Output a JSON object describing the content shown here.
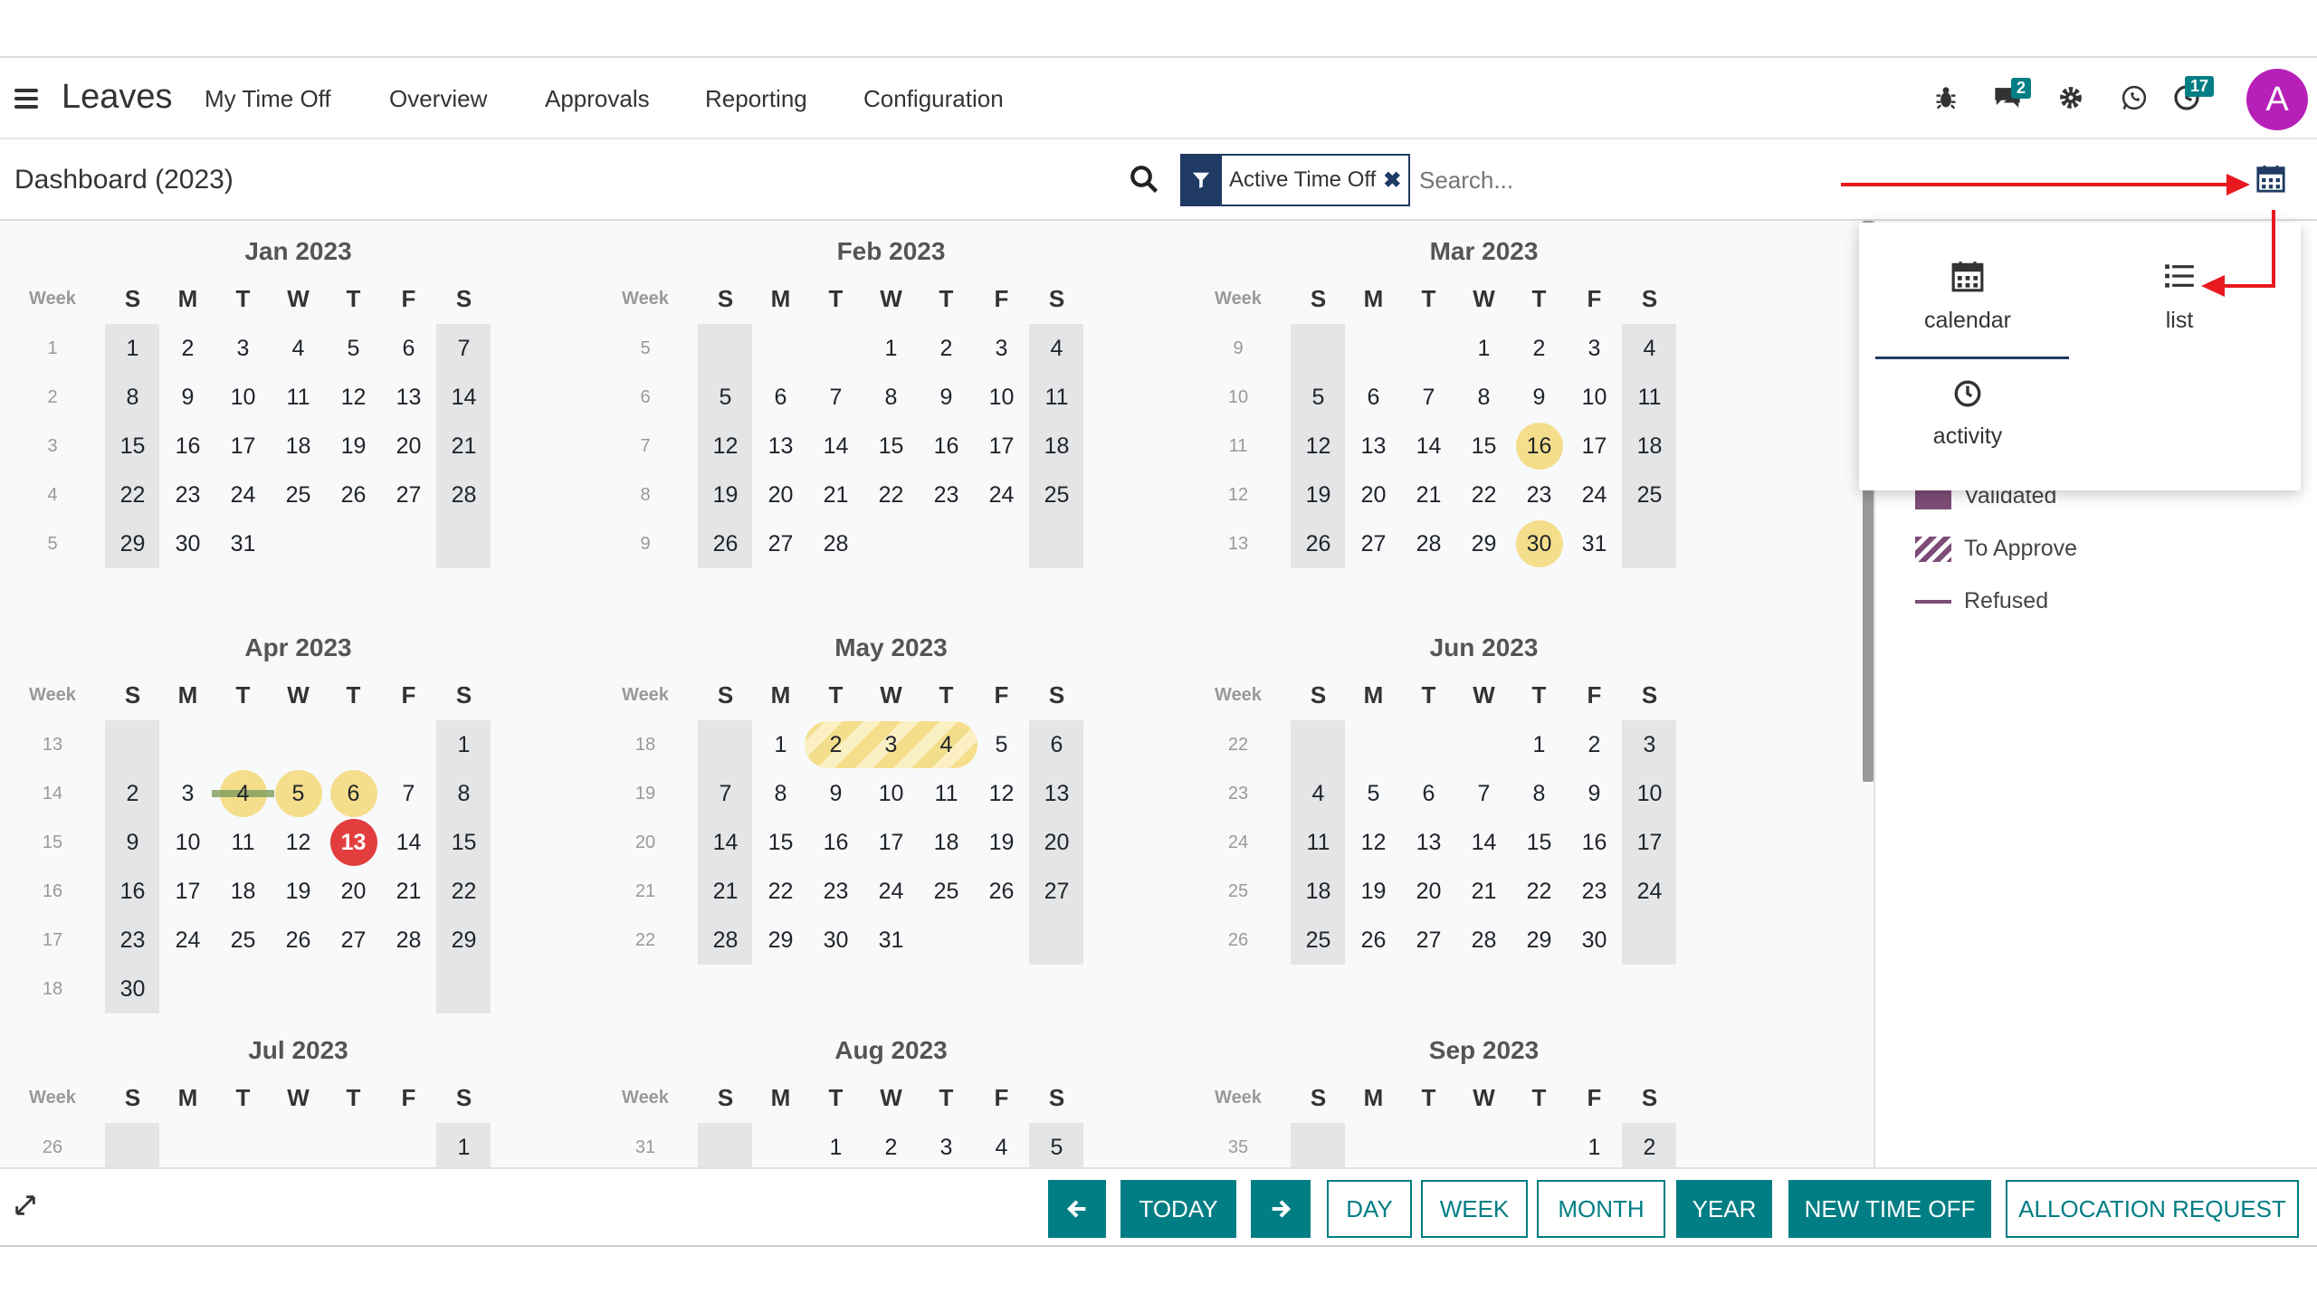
{
  "app": {
    "brand": "Leaves",
    "menu": [
      "My Time Off",
      "Overview",
      "Approvals",
      "Reporting",
      "Configuration"
    ],
    "icons": {
      "menu": "hamburger-icon",
      "bug": "bug-icon",
      "chat": "chat-icon",
      "settings": "gear-icon",
      "whatsapp": "whatsapp-icon",
      "activity": "clock-icon"
    },
    "chat_badge": "2",
    "activity_badge": "17",
    "avatar_letter": "A",
    "avatar_color": "#b620b8",
    "accent": "#017e84"
  },
  "control": {
    "title": "Dashboard (2023)",
    "facet_label": "Active Time Off",
    "search_placeholder": "Search..."
  },
  "view_switcher": {
    "calendar": "calendar",
    "list": "list",
    "activity": "activity"
  },
  "legend": [
    "Validated",
    "To Approve",
    "Refused"
  ],
  "calendar": {
    "week_label": "Week",
    "weekdays": [
      "S",
      "M",
      "T",
      "W",
      "T",
      "F",
      "S"
    ],
    "months": [
      {
        "title": "Jan 2023",
        "start": 0,
        "days": 31,
        "first_week": 1,
        "rows": 5
      },
      {
        "title": "Feb 2023",
        "start": 3,
        "days": 28,
        "first_week": 5,
        "rows": 5
      },
      {
        "title": "Mar 2023",
        "start": 3,
        "days": 31,
        "first_week": 9,
        "rows": 5
      },
      {
        "title": "Apr 2023",
        "start": 6,
        "days": 30,
        "first_week": 13,
        "rows": 6
      },
      {
        "title": "May 2023",
        "start": 1,
        "days": 31,
        "first_week": 18,
        "rows": 5
      },
      {
        "title": "Jun 2023",
        "start": 4,
        "days": 30,
        "first_week": 22,
        "rows": 5
      },
      {
        "title": "Jul 2023",
        "start": 6,
        "days": 31,
        "first_week": 26,
        "rows": 1
      },
      {
        "title": "Aug 2023",
        "start": 2,
        "days": 31,
        "first_week": 31,
        "rows": 1
      },
      {
        "title": "Sep 2023",
        "start": 5,
        "days": 30,
        "first_week": 35,
        "rows": 1
      }
    ],
    "highlighted": {
      "Mar 2023": [
        16,
        30
      ],
      "Apr 2023": [
        4,
        5,
        6
      ]
    },
    "today": {
      "month": "Apr 2023",
      "day": 13
    },
    "validated_range": {
      "month": "Apr 2023",
      "from": 4,
      "to": 4
    },
    "to_approve_range": {
      "month": "May 2023",
      "from": 2,
      "to": 4
    }
  },
  "bottom": {
    "today": "TODAY",
    "day": "DAY",
    "week": "WEEK",
    "month": "MONTH",
    "year": "YEAR",
    "new_time_off": "NEW TIME OFF",
    "allocation_request": "ALLOCATION REQUEST",
    "prev_icon": "arrow-left-icon",
    "next_icon": "arrow-right-icon",
    "expand_icon": "expand-icon"
  }
}
